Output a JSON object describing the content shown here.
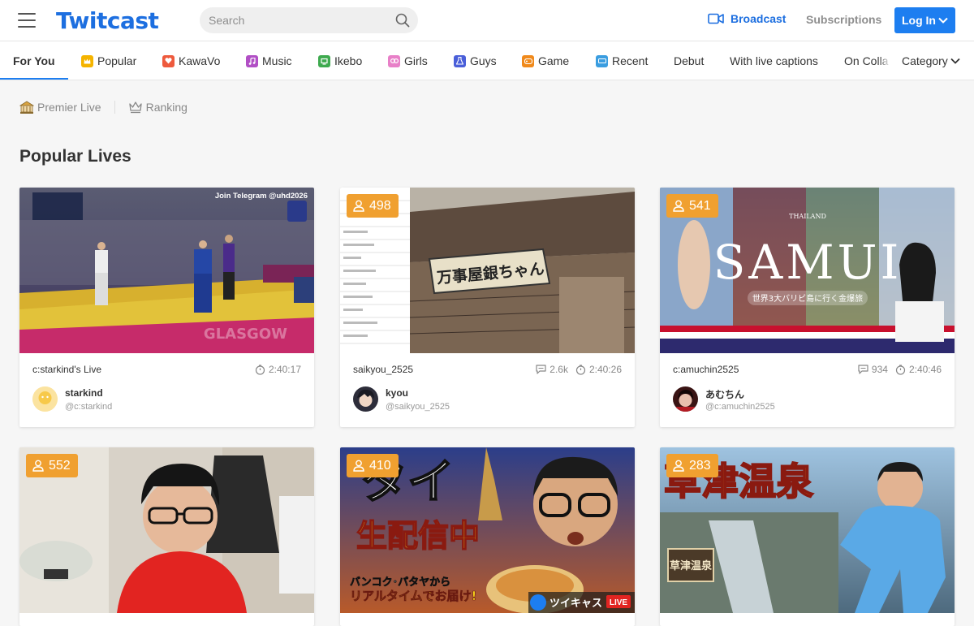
{
  "header": {
    "logo": "Twitcast",
    "search_placeholder": "Search",
    "broadcast_label": "Broadcast",
    "subscriptions_label": "Subscriptions",
    "login_label": "Log In",
    "brand_color": "#1d6fe0"
  },
  "categories": [
    {
      "label": "For You",
      "icon": "",
      "active": true
    },
    {
      "label": "Popular",
      "icon": "popular-icon",
      "color": "#f5b400"
    },
    {
      "label": "KawaVo",
      "icon": "kawavo-icon",
      "color": "#ee5a3d"
    },
    {
      "label": "Music",
      "icon": "music-icon",
      "color": "#b14fc5"
    },
    {
      "label": "Ikebo",
      "icon": "ikebo-icon",
      "color": "#3eaa4f"
    },
    {
      "label": "Girls",
      "icon": "girls-icon",
      "color": "#e880c8"
    },
    {
      "label": "Guys",
      "icon": "guys-icon",
      "color": "#4a5fd9"
    },
    {
      "label": "Game",
      "icon": "game-icon",
      "color": "#f08a1c"
    },
    {
      "label": "Recent",
      "icon": "recent-icon",
      "color": "#3a9de0"
    },
    {
      "label": "Debut",
      "icon": ""
    },
    {
      "label": "With live captions",
      "icon": ""
    },
    {
      "label": "On Colla",
      "icon": ""
    }
  ],
  "category_dropdown": "Category",
  "subnav": {
    "premier": "Premier Live",
    "ranking": "Ranking"
  },
  "section_title": "Popular Lives",
  "cards": [
    {
      "viewers": "",
      "title": "c:starkind's Live",
      "comments": "",
      "duration": "2:40:17",
      "name": "starkind",
      "id": "@c:starkind"
    },
    {
      "viewers": "498",
      "title": "saikyou_2525",
      "comments": "2.6k",
      "duration": "2:40:26",
      "name": "kyou",
      "id": "@saikyou_2525"
    },
    {
      "viewers": "541",
      "title": "c:amuchin2525",
      "comments": "934",
      "duration": "2:40:46",
      "name": "あむちん",
      "id": "@c:amuchin2525"
    },
    {
      "viewers": "552",
      "title": "",
      "comments": "",
      "duration": "",
      "name": "",
      "id": ""
    },
    {
      "viewers": "410",
      "title": "",
      "comments": "",
      "duration": "",
      "name": "",
      "id": ""
    },
    {
      "viewers": "283",
      "title": "",
      "comments": "",
      "duration": "",
      "name": "",
      "id": ""
    }
  ],
  "thumb_text": {
    "c1_top": "Join Telegram @uhd2026",
    "c1_banner": "GLASGOW",
    "c2_sign": "万事屋銀ちゃん",
    "c3_big": "SAMUI",
    "c3_small": "THAILAND",
    "c3_sub": "世界3大バリビ島に行く金爆旅",
    "c5_big": "タイ",
    "c5_mid": "生配信中",
    "c5_line1": "バンコク･パタヤから",
    "c5_line2": "リアルタイムでお届け!",
    "c5_logo": "ツイキャス",
    "c5_live": "LIVE",
    "c6_big": "草津温泉",
    "c6_sign": "草津温泉"
  }
}
